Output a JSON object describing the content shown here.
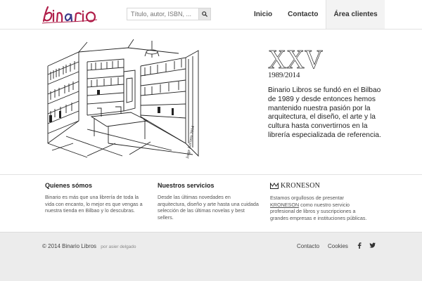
{
  "header": {
    "logo_text": "binario",
    "search_placeholder": "Título, autor, ISBN, ...",
    "nav": [
      {
        "label": "Inicio"
      },
      {
        "label": "Contacto"
      },
      {
        "label": "Área clientes"
      }
    ]
  },
  "hero": {
    "anniversary_numeral": "XXV",
    "years": "1989/2014",
    "text": "Binario Libros se fundó en el Bilbao de 1989 y desde entonces hemos mantenido nuestra pasión por la arquitectura, el diseño, el arte y la cultura hasta convertirnos en la librería especializada de referencia.",
    "sketch_signature": "Jorge Azcorro 2014"
  },
  "features": {
    "about": {
      "title": "Quienes sómos",
      "text": "Binario es más que una librería de toda la vida con encanto, lo mejor es que vengas a nuestra tienda en Bilbao y lo descubras."
    },
    "services": {
      "title": "Nuestros servicios",
      "text": "Desde las últimas novedades en arquitectura, diseño y arte hasta una cuidada selección de las últimas novelas y best sellers."
    },
    "kroneson": {
      "brand": "KRONESON",
      "text_before": "Estamos orgullosos de presentar",
      "link": "KRONESON",
      "text_after": "como nuestro servicio profesional de libros y suscripciones a grandes empresas e instituciones públicas."
    }
  },
  "footer": {
    "copyright": "© 2014 Binario Libros",
    "credit": "por asier delgado",
    "links": [
      "Contacto",
      "Cookies"
    ],
    "social": [
      "facebook-icon",
      "twitter-icon"
    ]
  },
  "colors": {
    "logo_accent": "#b01f4a",
    "logo_secondary": "#3a3a8a",
    "footer_bg": "#ececec",
    "active_nav_bg": "#f3f3f3"
  }
}
